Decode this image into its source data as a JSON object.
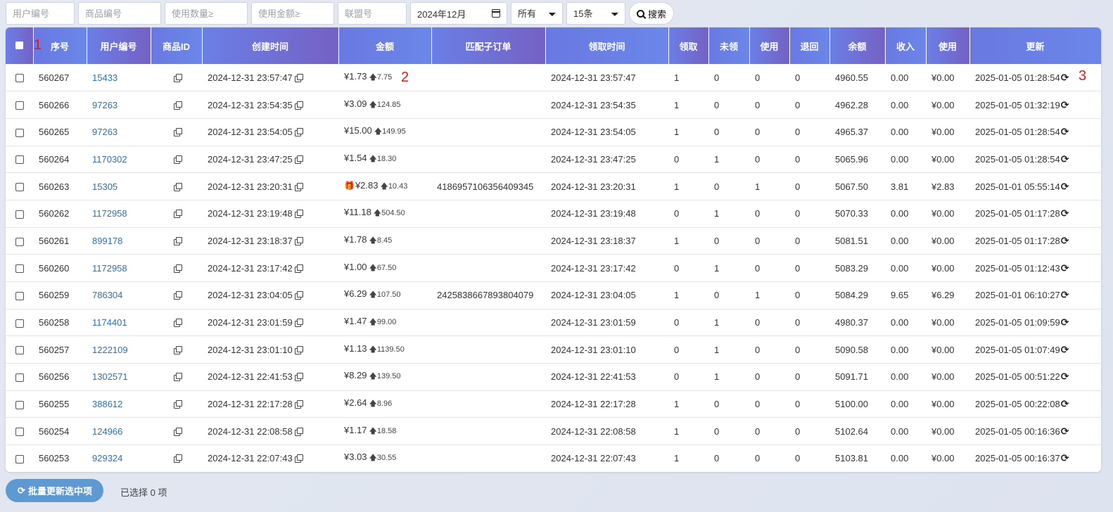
{
  "filters": {
    "user_id_placeholder": "用户编号",
    "product_id_placeholder": "商品编号",
    "usage_qty_placeholder": "使用数量≥",
    "usage_amount_placeholder": "使用金额≥",
    "union_id_placeholder": "联盟号",
    "month_value": "2024年12月",
    "status_selected": "所有",
    "page_size_selected": "15条",
    "search_label": "搜索"
  },
  "annotations": [
    "1",
    "2",
    "3"
  ],
  "table": {
    "headers": [
      "序号",
      "用户编号",
      "商品ID",
      "创建时间",
      "金额",
      "匹配子订单",
      "领取时间",
      "领取",
      "未领",
      "使用",
      "退回",
      "余额",
      "收入",
      "使用",
      "更新"
    ],
    "rows": [
      {
        "seq": "560267",
        "user": "15433",
        "created": "2024-12-31 23:57:47",
        "amount": "¥1.73",
        "amount_sub": "7.75",
        "gift": false,
        "suborder": "",
        "received_time": "2024-12-31 23:57:47",
        "received": "1",
        "unclaimed": "0",
        "used": "0",
        "returned": "0",
        "balance": "4960.55",
        "income": "0.00",
        "used_amount": "¥0.00",
        "updated": "2025-01-05 01:28:54"
      },
      {
        "seq": "560266",
        "user": "97263",
        "created": "2024-12-31 23:54:35",
        "amount": "¥3.09",
        "amount_sub": "124.85",
        "gift": false,
        "suborder": "",
        "received_time": "2024-12-31 23:54:35",
        "received": "1",
        "unclaimed": "0",
        "used": "0",
        "returned": "0",
        "balance": "4962.28",
        "income": "0.00",
        "used_amount": "¥0.00",
        "updated": "2025-01-05 01:32:19"
      },
      {
        "seq": "560265",
        "user": "97263",
        "created": "2024-12-31 23:54:05",
        "amount": "¥15.00",
        "amount_sub": "149.95",
        "gift": false,
        "suborder": "",
        "received_time": "2024-12-31 23:54:05",
        "received": "1",
        "unclaimed": "0",
        "used": "0",
        "returned": "0",
        "balance": "4965.37",
        "income": "0.00",
        "used_amount": "¥0.00",
        "updated": "2025-01-05 01:28:54"
      },
      {
        "seq": "560264",
        "user": "1170302",
        "created": "2024-12-31 23:47:25",
        "amount": "¥1.54",
        "amount_sub": "18.30",
        "gift": false,
        "suborder": "",
        "received_time": "2024-12-31 23:47:25",
        "received": "0",
        "unclaimed": "1",
        "used": "0",
        "returned": "0",
        "balance": "5065.96",
        "income": "0.00",
        "used_amount": "¥0.00",
        "updated": "2025-01-05 01:28:54"
      },
      {
        "seq": "560263",
        "user": "15305",
        "created": "2024-12-31 23:20:31",
        "amount": "¥2.83",
        "amount_sub": "10.43",
        "gift": true,
        "suborder": "4186957106356409345",
        "received_time": "2024-12-31 23:20:31",
        "received": "1",
        "unclaimed": "0",
        "used": "1",
        "returned": "0",
        "balance": "5067.50",
        "income": "3.81",
        "used_amount": "¥2.83",
        "updated": "2025-01-01 05:55:14"
      },
      {
        "seq": "560262",
        "user": "1172958",
        "created": "2024-12-31 23:19:48",
        "amount": "¥11.18",
        "amount_sub": "504.50",
        "gift": false,
        "suborder": "",
        "received_time": "2024-12-31 23:19:48",
        "received": "0",
        "unclaimed": "1",
        "used": "0",
        "returned": "0",
        "balance": "5070.33",
        "income": "0.00",
        "used_amount": "¥0.00",
        "updated": "2025-01-05 01:17:28"
      },
      {
        "seq": "560261",
        "user": "899178",
        "created": "2024-12-31 23:18:37",
        "amount": "¥1.78",
        "amount_sub": "8.45",
        "gift": false,
        "suborder": "",
        "received_time": "2024-12-31 23:18:37",
        "received": "1",
        "unclaimed": "0",
        "used": "0",
        "returned": "0",
        "balance": "5081.51",
        "income": "0.00",
        "used_amount": "¥0.00",
        "updated": "2025-01-05 01:17:28"
      },
      {
        "seq": "560260",
        "user": "1172958",
        "created": "2024-12-31 23:17:42",
        "amount": "¥1.00",
        "amount_sub": "67.50",
        "gift": false,
        "suborder": "",
        "received_time": "2024-12-31 23:17:42",
        "received": "0",
        "unclaimed": "1",
        "used": "0",
        "returned": "0",
        "balance": "5083.29",
        "income": "0.00",
        "used_amount": "¥0.00",
        "updated": "2025-01-05 01:12:43"
      },
      {
        "seq": "560259",
        "user": "786304",
        "created": "2024-12-31 23:04:05",
        "amount": "¥6.29",
        "amount_sub": "107.50",
        "gift": false,
        "suborder": "2425838667893804079",
        "received_time": "2024-12-31 23:04:05",
        "received": "1",
        "unclaimed": "0",
        "used": "1",
        "returned": "0",
        "balance": "5084.29",
        "income": "9.65",
        "used_amount": "¥6.29",
        "updated": "2025-01-01 06:10:27"
      },
      {
        "seq": "560258",
        "user": "1174401",
        "created": "2024-12-31 23:01:59",
        "amount": "¥1.47",
        "amount_sub": "99.00",
        "gift": false,
        "suborder": "",
        "received_time": "2024-12-31 23:01:59",
        "received": "0",
        "unclaimed": "1",
        "used": "0",
        "returned": "0",
        "balance": "4980.37",
        "income": "0.00",
        "used_amount": "¥0.00",
        "updated": "2025-01-05 01:09:59"
      },
      {
        "seq": "560257",
        "user": "1222109",
        "created": "2024-12-31 23:01:10",
        "amount": "¥1.13",
        "amount_sub": "1139.50",
        "gift": false,
        "suborder": "",
        "received_time": "2024-12-31 23:01:10",
        "received": "0",
        "unclaimed": "1",
        "used": "0",
        "returned": "0",
        "balance": "5090.58",
        "income": "0.00",
        "used_amount": "¥0.00",
        "updated": "2025-01-05 01:07:49"
      },
      {
        "seq": "560256",
        "user": "1302571",
        "created": "2024-12-31 22:41:53",
        "amount": "¥8.29",
        "amount_sub": "139.50",
        "gift": false,
        "suborder": "",
        "received_time": "2024-12-31 22:41:53",
        "received": "0",
        "unclaimed": "1",
        "used": "0",
        "returned": "0",
        "balance": "5091.71",
        "income": "0.00",
        "used_amount": "¥0.00",
        "updated": "2025-01-05 00:51:22"
      },
      {
        "seq": "560255",
        "user": "388612",
        "created": "2024-12-31 22:17:28",
        "amount": "¥2.64",
        "amount_sub": "8.96",
        "gift": false,
        "suborder": "",
        "received_time": "2024-12-31 22:17:28",
        "received": "1",
        "unclaimed": "0",
        "used": "0",
        "returned": "0",
        "balance": "5100.00",
        "income": "0.00",
        "used_amount": "¥0.00",
        "updated": "2025-01-05 00:22:08"
      },
      {
        "seq": "560254",
        "user": "124966",
        "created": "2024-12-31 22:08:58",
        "amount": "¥1.17",
        "amount_sub": "18.58",
        "gift": false,
        "suborder": "",
        "received_time": "2024-12-31 22:08:58",
        "received": "1",
        "unclaimed": "0",
        "used": "0",
        "returned": "0",
        "balance": "5102.64",
        "income": "0.00",
        "used_amount": "¥0.00",
        "updated": "2025-01-05 00:16:36"
      },
      {
        "seq": "560253",
        "user": "929324",
        "created": "2024-12-31 22:07:43",
        "amount": "¥3.03",
        "amount_sub": "30.55",
        "gift": false,
        "suborder": "",
        "received_time": "2024-12-31 22:07:43",
        "received": "1",
        "unclaimed": "0",
        "used": "0",
        "returned": "0",
        "balance": "5103.81",
        "income": "0.00",
        "used_amount": "¥0.00",
        "updated": "2025-01-05 00:16:37"
      }
    ]
  },
  "footer": {
    "batch_update_label": "批量更新选中项",
    "selected_text": "已选择 0 项"
  },
  "colors": {
    "header_gradient_start": "#6a7fe6",
    "header_gradient_end": "#7561c4",
    "link": "#2f6fb6",
    "batch_button": "#5e9ad1",
    "annotation": "#e11111"
  },
  "icons": {
    "search": "search-icon",
    "copy": "copy-icon",
    "up_arrow": "arrow-up-icon",
    "gift": "gift-icon",
    "refresh": "refresh-icon",
    "calendar": "calendar-icon"
  }
}
